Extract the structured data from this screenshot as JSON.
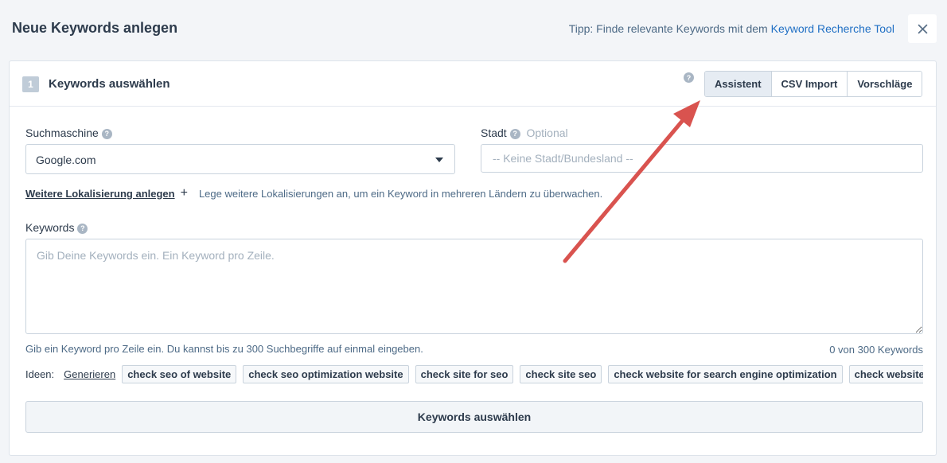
{
  "header": {
    "title": "Neue Keywords anlegen",
    "tip_prefix": "Tipp: Finde relevante Keywords mit dem",
    "tip_link": "Keyword Recherche Tool"
  },
  "card": {
    "step": "1",
    "title": "Keywords auswählen",
    "help": "?",
    "tabs": [
      "Assistent",
      "CSV Import",
      "Vorschläge"
    ]
  },
  "search_engine": {
    "label": "Suchmaschine",
    "value": "Google.com"
  },
  "city": {
    "label": "Stadt",
    "optional": "Optional",
    "placeholder": "-- Keine Stadt/Bundesland --"
  },
  "localization": {
    "link": "Weitere Lokalisierung anlegen",
    "plus": "+",
    "hint": "Lege weitere Lokalisierungen an, um ein Keyword in mehreren Ländern zu überwachen."
  },
  "keywords": {
    "label": "Keywords",
    "placeholder": "Gib Deine Keywords ein. Ein Keyword pro Zeile.",
    "hint": "Gib ein Keyword pro Zeile ein. Du kannst bis zu 300 Suchbegriffe auf einmal eingeben.",
    "counter": "0 von 300 Keywords"
  },
  "ideas": {
    "label": "Ideen:",
    "generate": "Generieren",
    "chips": [
      "check seo of website",
      "check seo optimization website",
      "check site for seo",
      "check site seo",
      "check website for search engine optimization",
      "check website seo"
    ]
  },
  "submit_label": "Keywords auswählen",
  "colors": {
    "accent_link": "#1f6fc4",
    "annotation_arrow": "#d9534f"
  }
}
